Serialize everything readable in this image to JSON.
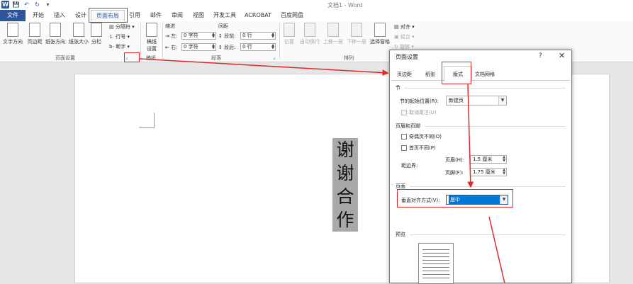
{
  "titlebar": {
    "title": "文档1 - Word",
    "word_logo": "W",
    "save_icon": "💾",
    "undo_icon": "↶",
    "redo_icon": "↻",
    "customize_icon": "▾"
  },
  "tabs": {
    "file": "文件",
    "home": "开始",
    "insert": "插入",
    "design": "设计",
    "layout": "页面布局",
    "references": "引用",
    "mailings": "邮件",
    "review": "审阅",
    "view": "视图",
    "developer": "开发工具",
    "acrobat": "ACROBAT",
    "baidu": "百度网盘"
  },
  "ribbon": {
    "page_setup": {
      "text_direction": "文字方向",
      "margins": "页边距",
      "orientation": "纸张方向",
      "size": "纸张大小",
      "columns": "分栏",
      "breaks": "分隔符",
      "line_numbers": "行号",
      "hyphenation": "断字",
      "label": "页面设置"
    },
    "draft": {
      "button_line1": "稿纸",
      "button_line2": "设置",
      "label": "稿纸"
    },
    "paragraph": {
      "indent_label": "缩进",
      "left_label": "左:",
      "left_value": "0 字符",
      "right_label": "右:",
      "right_value": "0 字符",
      "spacing_label": "间距",
      "before_label": "段前:",
      "before_value": "0 行",
      "after_label": "段后:",
      "after_value": "0 行",
      "label": "段落"
    },
    "arrange": {
      "position": "位置",
      "wrap_text": "自动换行",
      "bring_forward": "上移一层",
      "send_backward": "下移一层",
      "selection_pane": "选择窗格",
      "align": "对齐",
      "group": "组合",
      "rotate": "旋转",
      "label": "排列"
    }
  },
  "document": {
    "chars": [
      "谢",
      "谢",
      "合",
      "作"
    ]
  },
  "dialog": {
    "title": "页面设置",
    "help": "?",
    "close": "✕",
    "tabs": [
      "页边距",
      "纸张",
      "版式",
      "文档网格"
    ],
    "section": {
      "heading": "节",
      "start_label": "节的起始位置(R):",
      "start_value": "新建页",
      "suppress_endnotes": "取消尾注(U)"
    },
    "headers_footers": {
      "heading": "页眉和页脚",
      "odd_even": "奇偶页不同(O)",
      "first_page": "首页不同(P)",
      "from_edge": "距边界:",
      "header_label": "页眉(H):",
      "header_value": "1.5 厘米",
      "footer_label": "页脚(F):",
      "footer_value": "1.75 厘米"
    },
    "page": {
      "heading": "页面",
      "valign_label": "垂直对齐方式(V):",
      "valign_value": "居中"
    },
    "preview": {
      "heading": "预览"
    }
  },
  "colors": {
    "accent": "#2b579a",
    "annotation": "#e02a2a",
    "selection": "#0078d7"
  }
}
